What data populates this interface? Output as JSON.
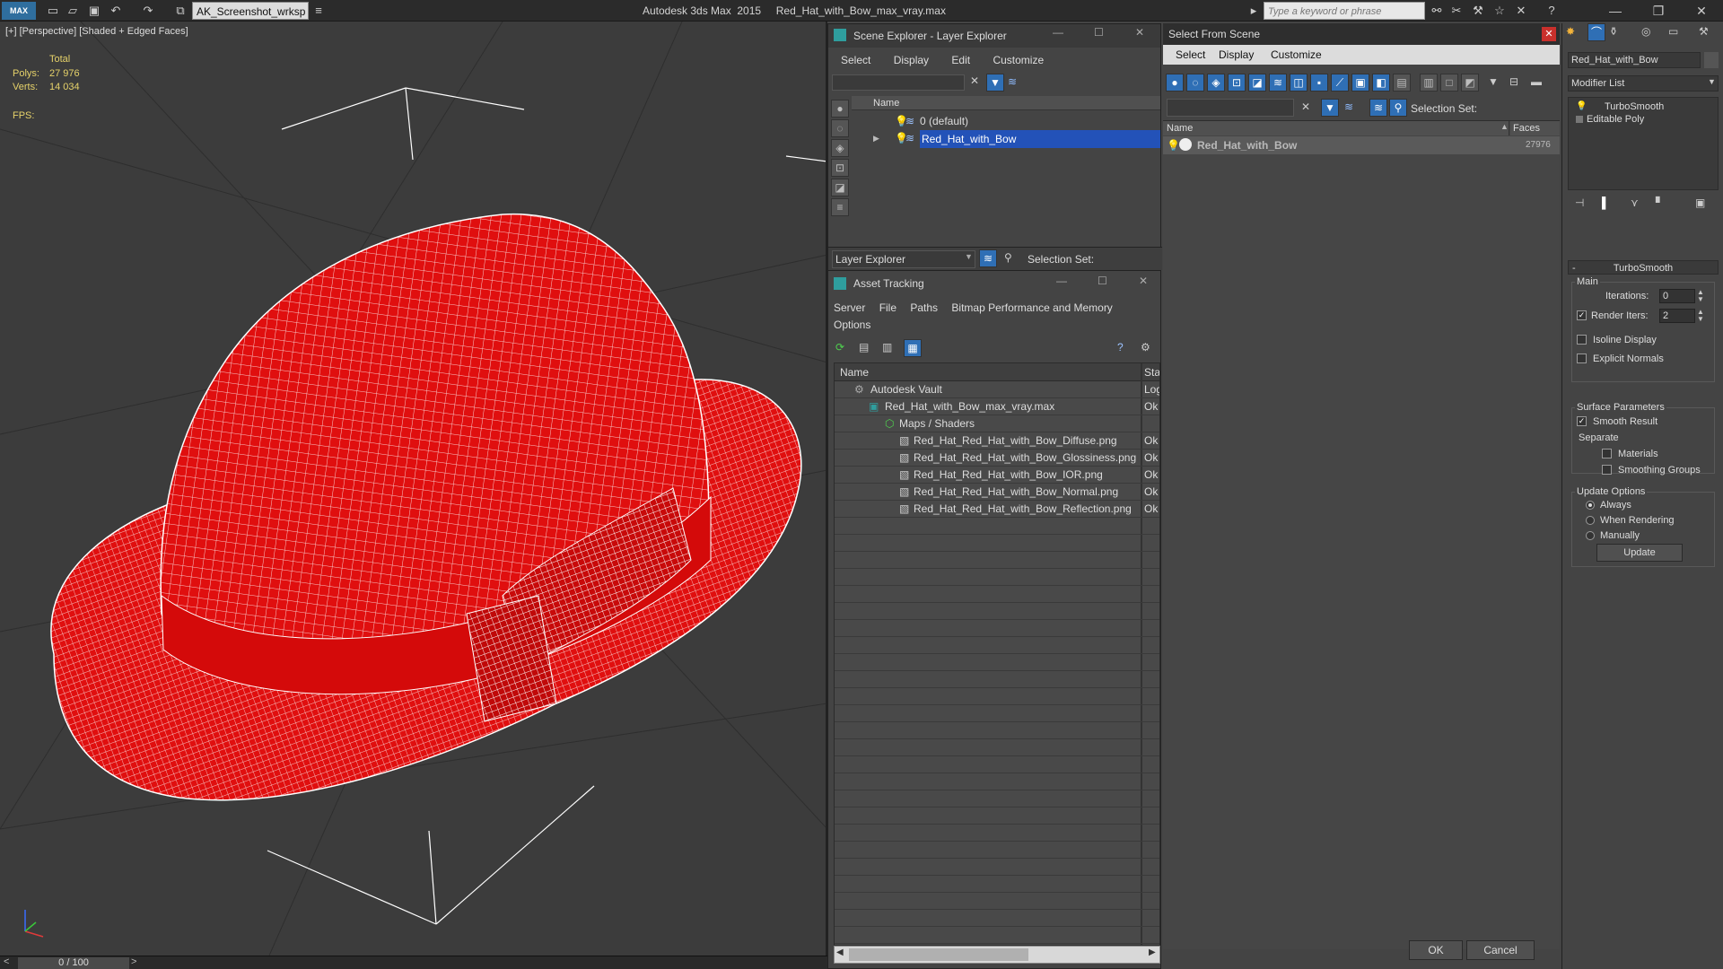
{
  "titlebar": {
    "logo": "MAX",
    "workspace": "AK_Screenshot_wrksp",
    "app_title": "Autodesk 3ds Max  2015     Red_Hat_with_Bow_max_vray.max",
    "search_placeholder": "Type a keyword or phrase"
  },
  "viewport": {
    "label": "[+] [Perspective] [Shaded + Edged Faces]",
    "stats_total": "Total",
    "polys_label": "Polys:",
    "polys_value": "27 976",
    "verts_label": "Verts:",
    "verts_value": "14 034",
    "fps_label": "FPS:",
    "mesh_color": "#e00f0f",
    "wire_color": "#ffffff"
  },
  "timeline": {
    "frame": "0 / 100"
  },
  "scene_explorer": {
    "title": "Scene Explorer - Layer Explorer",
    "menu": [
      "Select",
      "Display",
      "Edit",
      "Customize"
    ],
    "column_name": "Name",
    "layers": [
      {
        "name": "0 (default)",
        "selected": false
      },
      {
        "name": "Red_Hat_with_Bow",
        "selected": true
      }
    ],
    "footer_dropdown": "Layer Explorer",
    "selection_set_label": "Selection Set:"
  },
  "asset_tracking": {
    "title": "Asset Tracking",
    "menu": [
      "Server",
      "File",
      "Paths",
      "Bitmap Performance and Memory",
      "Options"
    ],
    "col_name": "Name",
    "col_status": "Stat",
    "rows": [
      {
        "name": "Autodesk Vault",
        "status": "Log",
        "indent": 0
      },
      {
        "name": "Red_Hat_with_Bow_max_vray.max",
        "status": "Ok",
        "indent": 1
      },
      {
        "name": "Maps / Shaders",
        "status": "",
        "indent": 2
      },
      {
        "name": "Red_Hat_Red_Hat_with_Bow_Diffuse.png",
        "status": "Ok",
        "indent": 3
      },
      {
        "name": "Red_Hat_Red_Hat_with_Bow_Glossiness.png",
        "status": "Ok",
        "indent": 3
      },
      {
        "name": "Red_Hat_Red_Hat_with_Bow_IOR.png",
        "status": "Ok",
        "indent": 3
      },
      {
        "name": "Red_Hat_Red_Hat_with_Bow_Normal.png",
        "status": "Ok",
        "indent": 3
      },
      {
        "name": "Red_Hat_Red_Hat_with_Bow_Reflection.png",
        "status": "Ok",
        "indent": 3
      }
    ]
  },
  "select_from_scene": {
    "title": "Select From Scene",
    "menu": [
      "Select",
      "Display",
      "Customize"
    ],
    "selection_set_label": "Selection Set:",
    "col_name": "Name",
    "col_faces": "Faces",
    "rows": [
      {
        "name": "Red_Hat_with_Bow",
        "faces": "27976"
      }
    ],
    "ok": "OK",
    "cancel": "Cancel"
  },
  "modify_panel": {
    "object_name": "Red_Hat_with_Bow",
    "modifier_list": "Modifier List",
    "stack": [
      "TurboSmooth",
      "Editable Poly"
    ],
    "rollout_title": "TurboSmooth",
    "main_group": "Main",
    "iterations_label": "Iterations:",
    "iterations_value": "0",
    "render_iters_label": "Render Iters:",
    "render_iters_value": "2",
    "isoline_display": "Isoline Display",
    "explicit_normals": "Explicit Normals",
    "surface_params": "Surface Parameters",
    "smooth_result": "Smooth Result",
    "separate": "Separate",
    "materials": "Materials",
    "smoothing_groups": "Smoothing Groups",
    "update_options": "Update Options",
    "always": "Always",
    "when_rendering": "When Rendering",
    "manually": "Manually",
    "update_button": "Update"
  }
}
